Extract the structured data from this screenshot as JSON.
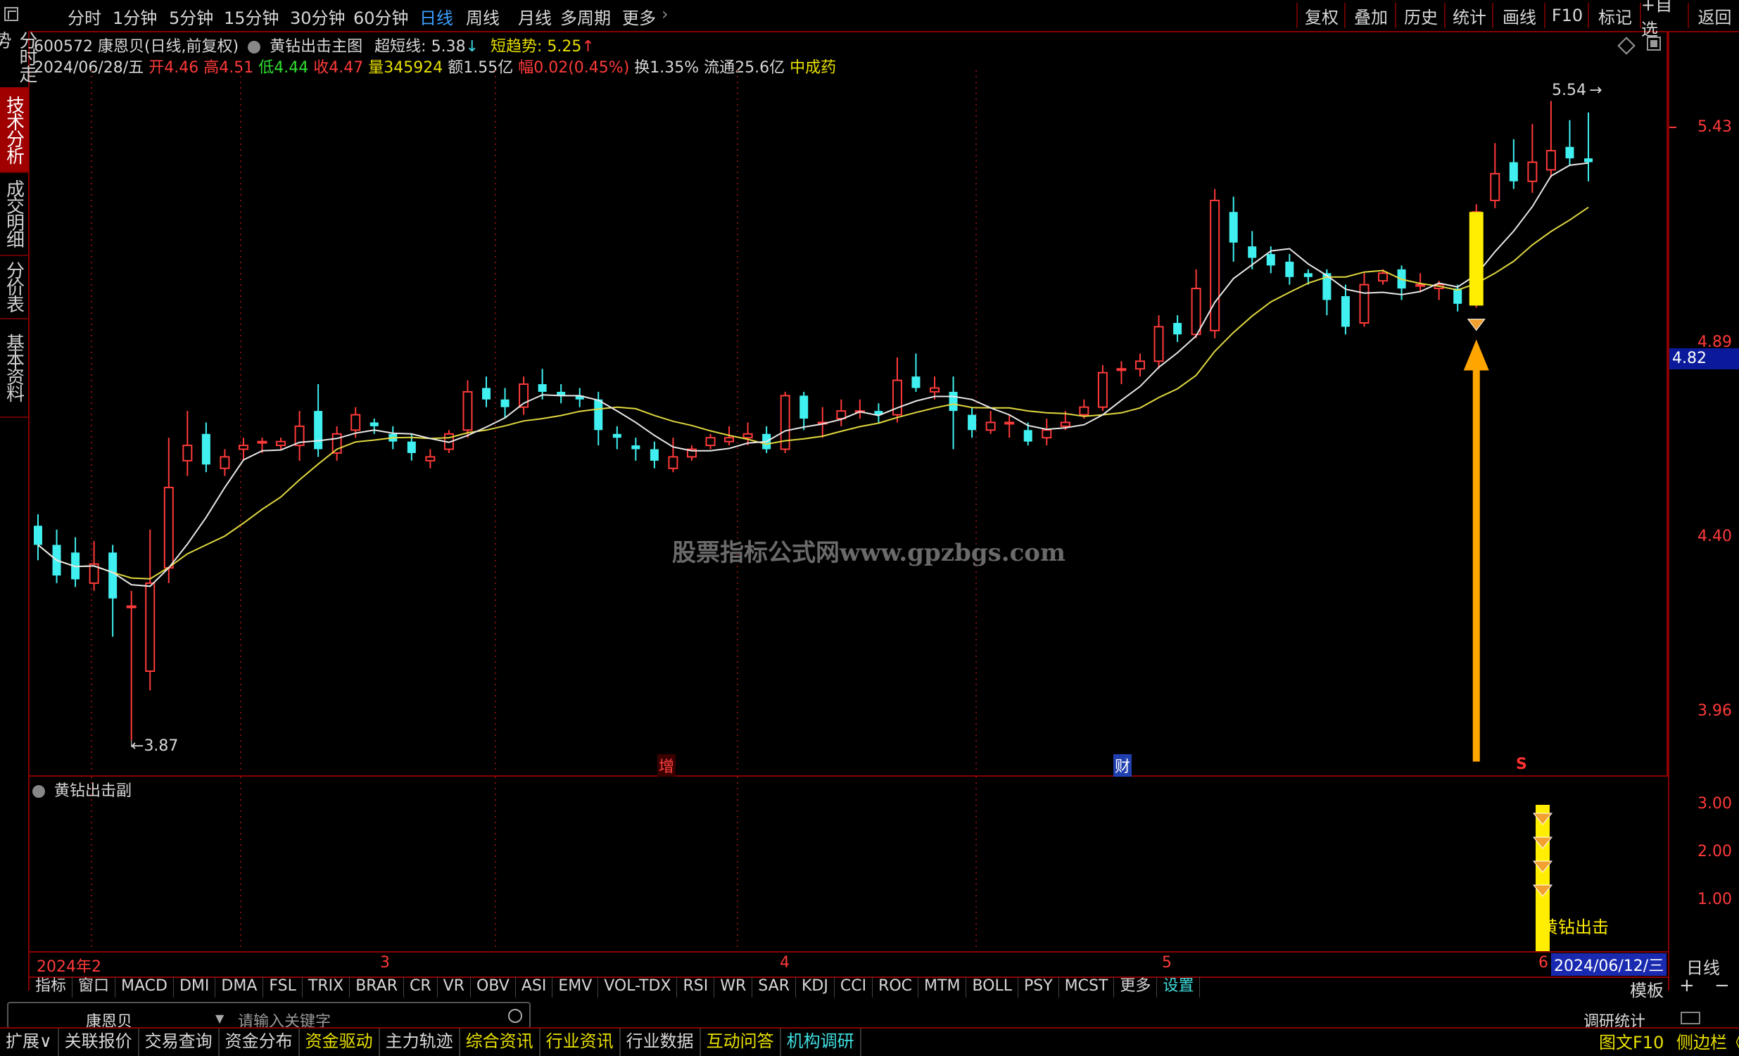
{
  "periods": [
    "分时",
    "1分钟",
    "5分钟",
    "15分钟",
    "30分钟",
    "60分钟",
    "日线",
    "周线",
    "月线",
    "多周期",
    "更多"
  ],
  "active_period": "日线",
  "right_tools": [
    "复权",
    "叠加",
    "历史",
    "统计",
    "画线",
    "F10",
    "标记",
    "+自选",
    "返回"
  ],
  "side_tabs": [
    "分时走势",
    "技术分析",
    "成交明细",
    "分价表",
    "基本资料"
  ],
  "active_side_tab": "技术分析",
  "stock": {
    "code_name": "600572 康恩贝(日线,前复权)",
    "main_indicator": "黄钻出击主图",
    "super_short_label": "超短线:",
    "super_short_value": "5.38",
    "short_trend_label": "短趋势:",
    "short_trend_value": "5.25"
  },
  "quote": {
    "date": "2024/06/28/五",
    "open_label": "开",
    "open": "4.46",
    "high_label": "高",
    "high": "4.51",
    "low_label": "低",
    "low": "4.44",
    "close_label": "收",
    "close": "4.47",
    "vol_label": "量",
    "vol": "345924",
    "amount": "额1.55亿",
    "range_label": "幅",
    "range": "0.02(0.45%)",
    "turnover": "换1.35%",
    "float": "流通25.6亿",
    "sector": "中成药"
  },
  "price_axis": [
    "5.43",
    "4.89",
    "4.40",
    "3.96"
  ],
  "current_price_tag": "4.82",
  "annotations": {
    "high": "5.54",
    "low": "3.87",
    "event_add": "增",
    "event_fin": "财",
    "event_s": "S"
  },
  "watermark": "股票指标公式网www.gpzbgs.com",
  "sub_panel": {
    "title": "黄钻出击副",
    "axis": [
      "3.00",
      "2.00",
      "1.00"
    ],
    "signal_text": "黄钻出击"
  },
  "time_axis": {
    "labels": [
      "2024年2",
      "3",
      "4",
      "5",
      "6"
    ],
    "cursor_date": "2024/06/12/三",
    "period_btn": "日线"
  },
  "indicators": [
    "指标",
    "窗口",
    "MACD",
    "DMI",
    "DMA",
    "FSL",
    "TRIX",
    "BRAR",
    "CR",
    "VR",
    "OBV",
    "ASI",
    "EMV",
    "VOL-TDX",
    "RSI",
    "WR",
    "SAR",
    "KDJ",
    "CCI",
    "ROC",
    "MTM",
    "BOLL",
    "PSY",
    "MCST",
    "更多",
    "设置"
  ],
  "indicator_right": [
    "模板",
    "+",
    "−"
  ],
  "search": {
    "stock_name": "康恩贝",
    "placeholder": "请输入关键字",
    "right_label": "调研统计"
  },
  "bottom_tabs": [
    "扩展∨",
    "关联报价",
    "交易查询",
    "资金分布",
    "资金驱动",
    "主力轨迹",
    "综合资讯",
    "行业资讯",
    "行业数据",
    "互动问答",
    "机构调研"
  ],
  "bottom_right": [
    "图文F10",
    "侧边栏《"
  ],
  "colors": {
    "up": "#ff3a3a",
    "down": "#40f0f0",
    "ma5": "#e8e8e8",
    "ma10": "#e0d840",
    "signal": "#ffee00",
    "frame": "#8a0000"
  },
  "chart_data": {
    "type": "candlestick",
    "price_range": [
      3.8,
      5.62
    ],
    "candles": [
      [
        4.43,
        4.38,
        4.46,
        4.34
      ],
      [
        4.38,
        4.3,
        4.42,
        4.28
      ],
      [
        4.36,
        4.29,
        4.4,
        4.27
      ],
      [
        4.28,
        4.33,
        4.39,
        4.26
      ],
      [
        4.36,
        4.24,
        4.38,
        4.14
      ],
      [
        4.22,
        4.22,
        4.26,
        3.87
      ],
      [
        4.05,
        4.28,
        4.42,
        4.0
      ],
      [
        4.32,
        4.53,
        4.66,
        4.28
      ],
      [
        4.6,
        4.64,
        4.73,
        4.56
      ],
      [
        4.67,
        4.59,
        4.7,
        4.57
      ],
      [
        4.58,
        4.61,
        4.63,
        4.56
      ],
      [
        4.63,
        4.64,
        4.66,
        4.6
      ],
      [
        4.65,
        4.65,
        4.66,
        4.62
      ],
      [
        4.64,
        4.65,
        4.66,
        4.63
      ],
      [
        4.64,
        4.69,
        4.73,
        4.6
      ],
      [
        4.73,
        4.63,
        4.8,
        4.61
      ],
      [
        4.62,
        4.67,
        4.69,
        4.6
      ],
      [
        4.68,
        4.72,
        4.74,
        4.66
      ],
      [
        4.7,
        4.69,
        4.71,
        4.67
      ],
      [
        4.67,
        4.65,
        4.69,
        4.63
      ],
      [
        4.65,
        4.62,
        4.67,
        4.6
      ],
      [
        4.6,
        4.61,
        4.63,
        4.58
      ],
      [
        4.63,
        4.67,
        4.68,
        4.62
      ],
      [
        4.68,
        4.78,
        4.81,
        4.66
      ],
      [
        4.79,
        4.76,
        4.82,
        4.74
      ],
      [
        4.76,
        4.74,
        4.79,
        4.71
      ],
      [
        4.74,
        4.8,
        4.82,
        4.72
      ],
      [
        4.8,
        4.78,
        4.84,
        4.76
      ],
      [
        4.78,
        4.77,
        4.8,
        4.75
      ],
      [
        4.77,
        4.76,
        4.79,
        4.74
      ],
      [
        4.76,
        4.68,
        4.78,
        4.64
      ],
      [
        4.67,
        4.66,
        4.69,
        4.63
      ],
      [
        4.64,
        4.63,
        4.66,
        4.6
      ],
      [
        4.63,
        4.6,
        4.65,
        4.58
      ],
      [
        4.58,
        4.61,
        4.66,
        4.57
      ],
      [
        4.61,
        4.63,
        4.64,
        4.6
      ],
      [
        4.64,
        4.66,
        4.67,
        4.63
      ],
      [
        4.65,
        4.66,
        4.69,
        4.64
      ],
      [
        4.66,
        4.67,
        4.7,
        4.64
      ],
      [
        4.67,
        4.63,
        4.69,
        4.62
      ],
      [
        4.63,
        4.77,
        4.78,
        4.62
      ],
      [
        4.77,
        4.71,
        4.78,
        4.68
      ],
      [
        4.7,
        4.7,
        4.74,
        4.66
      ],
      [
        4.71,
        4.73,
        4.76,
        4.69
      ],
      [
        4.73,
        4.73,
        4.76,
        4.71
      ],
      [
        4.73,
        4.72,
        4.75,
        4.7
      ],
      [
        4.72,
        4.81,
        4.87,
        4.7
      ],
      [
        4.82,
        4.79,
        4.88,
        4.78
      ],
      [
        4.78,
        4.79,
        4.82,
        4.76
      ],
      [
        4.78,
        4.73,
        4.82,
        4.63
      ],
      [
        4.72,
        4.68,
        4.74,
        4.66
      ],
      [
        4.68,
        4.7,
        4.73,
        4.67
      ],
      [
        4.7,
        4.7,
        4.72,
        4.66
      ],
      [
        4.68,
        4.65,
        4.7,
        4.64
      ],
      [
        4.66,
        4.68,
        4.71,
        4.64
      ],
      [
        4.69,
        4.7,
        4.73,
        4.68
      ],
      [
        4.72,
        4.74,
        4.76,
        4.71
      ],
      [
        4.74,
        4.83,
        4.85,
        4.73
      ],
      [
        4.84,
        4.84,
        4.86,
        4.8
      ],
      [
        4.84,
        4.86,
        4.88,
        4.82
      ],
      [
        4.86,
        4.95,
        4.98,
        4.84
      ],
      [
        4.96,
        4.93,
        4.98,
        4.91
      ],
      [
        4.93,
        5.05,
        5.1,
        4.92
      ],
      [
        4.94,
        5.28,
        5.31,
        4.92
      ],
      [
        5.25,
        5.17,
        5.29,
        5.12
      ],
      [
        5.16,
        5.13,
        5.2,
        5.1
      ],
      [
        5.14,
        5.11,
        5.16,
        5.09
      ],
      [
        5.12,
        5.08,
        5.14,
        5.06
      ],
      [
        5.09,
        5.08,
        5.1,
        5.06
      ],
      [
        5.09,
        5.02,
        5.1,
        4.98
      ],
      [
        5.03,
        4.95,
        5.06,
        4.93
      ],
      [
        4.96,
        5.06,
        5.09,
        4.95
      ],
      [
        5.07,
        5.09,
        5.1,
        5.06
      ],
      [
        5.1,
        5.05,
        5.11,
        5.02
      ],
      [
        5.06,
        5.06,
        5.09,
        5.04
      ],
      [
        5.05,
        5.06,
        5.07,
        5.02
      ],
      [
        5.05,
        5.01,
        5.06,
        4.99
      ],
      [
        5.02,
        5.25,
        5.27,
        5.0
      ],
      [
        5.28,
        5.35,
        5.43,
        5.26
      ],
      [
        5.38,
        5.33,
        5.44,
        5.31
      ],
      [
        5.33,
        5.38,
        5.48,
        5.3
      ],
      [
        5.36,
        5.41,
        5.54,
        5.34
      ],
      [
        5.42,
        5.39,
        5.49,
        5.37
      ],
      [
        5.39,
        5.38,
        5.51,
        5.33
      ]
    ]
  }
}
